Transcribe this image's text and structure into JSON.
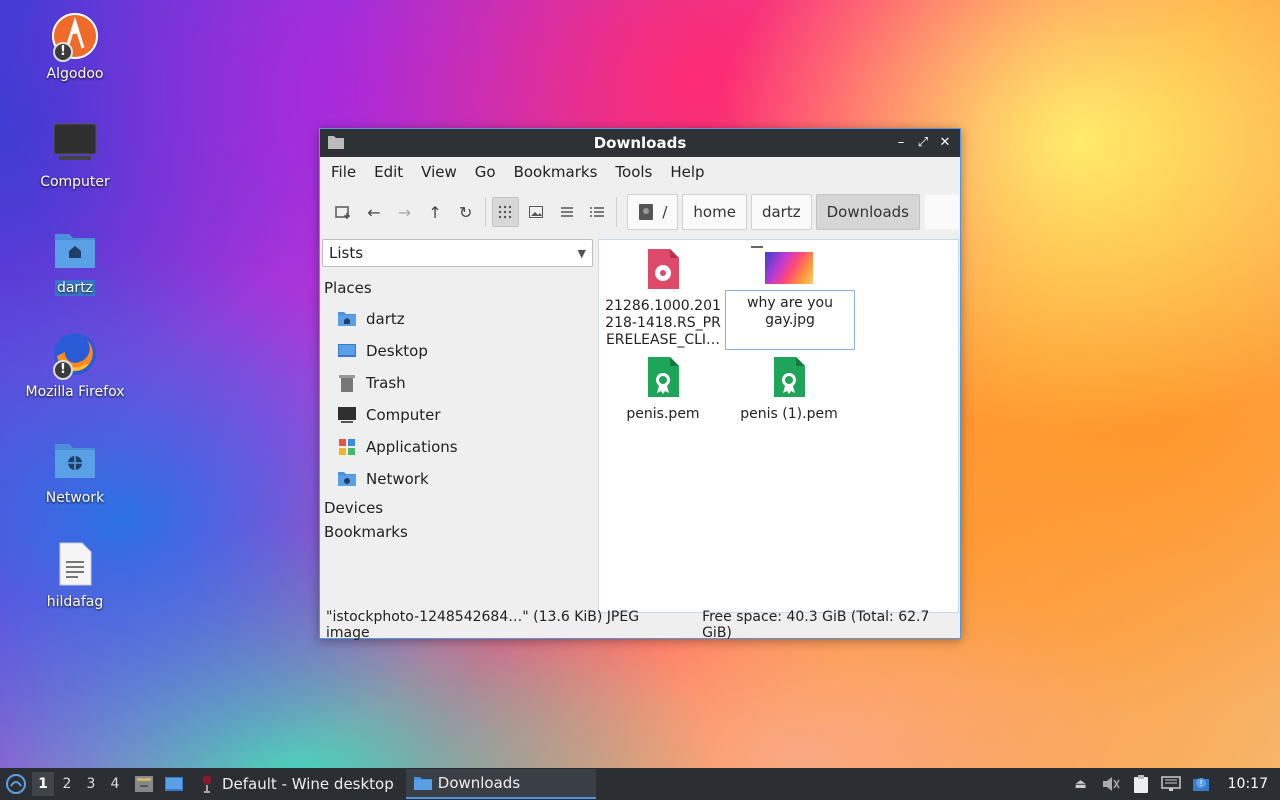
{
  "desktop": {
    "icons": [
      {
        "label": "Algodoo",
        "icon": "algodoo-icon"
      },
      {
        "label": "Computer",
        "icon": "computer-icon"
      },
      {
        "label": "dartz",
        "icon": "home-folder-icon"
      },
      {
        "label": "Mozilla Firefox",
        "icon": "firefox-icon"
      },
      {
        "label": "Network",
        "icon": "network-folder-icon"
      },
      {
        "label": "hildafag",
        "icon": "text-file-icon"
      }
    ]
  },
  "window": {
    "title": "Downloads",
    "menu": [
      "File",
      "Edit",
      "View",
      "Go",
      "Bookmarks",
      "Tools",
      "Help"
    ],
    "breadcrumbs": [
      "/",
      "home",
      "dartz",
      "Downloads"
    ],
    "sidebar": {
      "view_select": "Lists",
      "places_heading": "Places",
      "places": [
        "dartz",
        "Desktop",
        "Trash",
        "Computer",
        "Applications",
        "Network"
      ],
      "devices_heading": "Devices",
      "bookmarks_heading": "Bookmarks"
    },
    "files": [
      {
        "name": "21286.1000.201218-1418.RS_PRERELEASE_CLI…",
        "icon": "disc-image-icon"
      },
      {
        "name": "why are you gay.jpg",
        "icon": "image-thumbnail",
        "renaming": true
      },
      {
        "name": "penis.pem",
        "icon": "certificate-icon"
      },
      {
        "name": "penis (1).pem",
        "icon": "certificate-icon"
      }
    ],
    "file0_lines": [
      "21286.1000.201",
      "218-1418.RS_PR",
      "ERELEASE_CLI…"
    ],
    "rename_lines": [
      "why are you",
      "gay.jpg"
    ],
    "status": {
      "selection": "\"istockphoto-1248542684…\" (13.6 KiB) JPEG image",
      "free_space": "Free space: 40.3 GiB (Total: 62.7 GiB)"
    }
  },
  "taskbar": {
    "workspaces": [
      "1",
      "2",
      "3",
      "4"
    ],
    "active_workspace": "1",
    "tasks": [
      {
        "label": "Default - Wine desktop",
        "icon": "wine-icon"
      },
      {
        "label": "Downloads",
        "icon": "folder-icon",
        "active": true
      }
    ],
    "clock": "10:17"
  }
}
